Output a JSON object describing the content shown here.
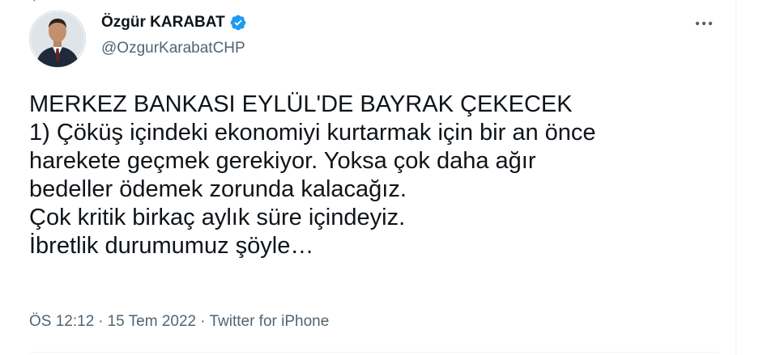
{
  "author": {
    "display_name": "Özgür KARABAT",
    "handle": "@OzgurKarabatCHP",
    "verified": true,
    "verified_color": "#1d9bf0"
  },
  "tweet": {
    "lines": [
      "MERKEZ BANKASI EYLÜL'DE BAYRAK ÇEKECEK",
      "1) Çöküş içindeki ekonomiyi kurtarmak için bir an önce",
      "harekete geçmek gerekiyor. Yoksa çok daha ağır",
      "bedeller ödemek zorunda kalacağız.",
      "Çok kritik birkaç aylık süre içindeyiz.",
      "İbretlik durumumuz şöyle…"
    ]
  },
  "meta": {
    "time": "ÖS 12:12",
    "date": "15 Tem 2022",
    "source": "Twitter for iPhone",
    "separator": "·"
  },
  "icons": {
    "more": "more-options-icon",
    "verified": "verified-badge-icon",
    "avatar": "profile-photo"
  }
}
